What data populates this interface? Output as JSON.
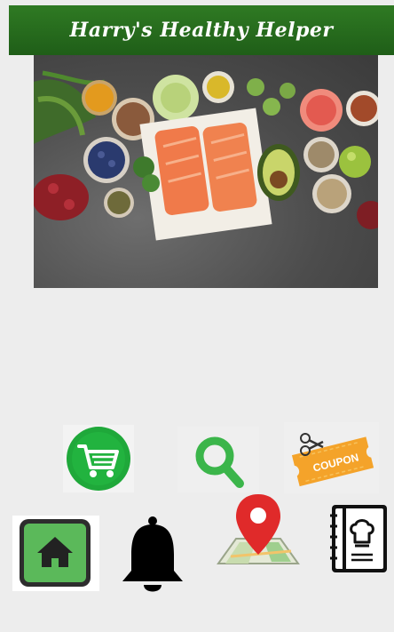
{
  "header": {
    "title": "Harry's Healthy Helper"
  },
  "hero": {
    "alt": "Healthy foods: salmon, avocado, vegetables, berries and grains"
  },
  "actions": {
    "cart_icon": "shopping-cart-icon",
    "search_icon": "search-icon",
    "coupon_icon": "coupon-icon",
    "coupon_label": "COUPON"
  },
  "bottom_nav": {
    "home_icon": "home-icon",
    "bell_icon": "bell-icon",
    "map_icon": "map-pin-icon",
    "recipe_icon": "recipe-book-icon"
  },
  "colors": {
    "header_green": "#2a7a20",
    "accent_green": "#1fa83a",
    "coupon_orange": "#f4a32a",
    "pin_red": "#e02a2a",
    "background": "#ededed"
  }
}
